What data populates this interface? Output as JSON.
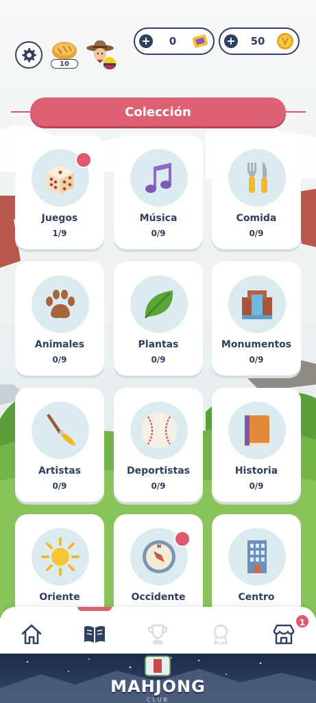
{
  "header": {
    "level": "10",
    "ticket_count": "0",
    "coin_count": "50"
  },
  "title": "Colección",
  "categories": [
    {
      "label": "Juegos",
      "count": "1/9",
      "icon": "dice-icon",
      "has_notification": true
    },
    {
      "label": "Música",
      "count": "0/9",
      "icon": "music-note-icon",
      "has_notification": false
    },
    {
      "label": "Comida",
      "count": "0/9",
      "icon": "fork-knife-icon",
      "has_notification": false
    },
    {
      "label": "Animales",
      "count": "0/9",
      "icon": "paw-icon",
      "has_notification": false
    },
    {
      "label": "Plantas",
      "count": "0/9",
      "icon": "leaf-icon",
      "has_notification": false
    },
    {
      "label": "Monumentos",
      "count": "0/9",
      "icon": "monument-icon",
      "has_notification": false
    },
    {
      "label": "Artistas",
      "count": "0/9",
      "icon": "paintbrush-icon",
      "has_notification": false
    },
    {
      "label": "Deportistas",
      "count": "0/9",
      "icon": "baseball-icon",
      "has_notification": false
    },
    {
      "label": "Historia",
      "count": "0/9",
      "icon": "book-icon",
      "has_notification": false
    },
    {
      "label": "Oriente",
      "count": "",
      "icon": "sun-icon",
      "has_notification": false
    },
    {
      "label": "Occidente",
      "count": "",
      "icon": "compass-icon",
      "has_notification": true
    },
    {
      "label": "Centro",
      "count": "",
      "icon": "building-icon",
      "has_notification": false
    }
  ],
  "nav": {
    "items": [
      "home-icon",
      "book-open-icon",
      "trophy-icon",
      "medal-icon",
      "shop-icon"
    ],
    "shop_badge": "1"
  },
  "ad": {
    "title": "MAHJONG",
    "subtitle": "CLUB"
  },
  "colors": {
    "accent": "#de6075",
    "navy": "#2e3f62",
    "circle_bg": "#dcebf0"
  }
}
